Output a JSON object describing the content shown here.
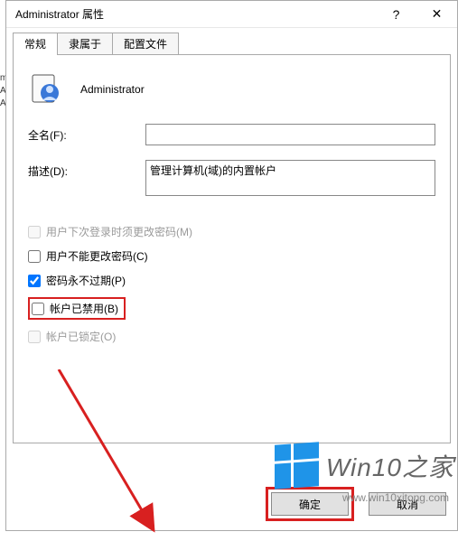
{
  "titlebar": {
    "title": "Administrator 属性",
    "help": "?",
    "close": "✕"
  },
  "tabs": {
    "general": "常规",
    "memberof": "隶属于",
    "profile": "配置文件"
  },
  "header": {
    "username": "Administrator"
  },
  "fields": {
    "fullname_label": "全名(F):",
    "fullname_value": "",
    "desc_label": "描述(D):",
    "desc_value": "管理计算机(域)的内置帐户"
  },
  "checkboxes": {
    "must_change": "用户下次登录时须更改密码(M)",
    "cannot_change": "用户不能更改密码(C)",
    "never_expire": "密码永不过期(P)",
    "disabled": "帐户已禁用(B)",
    "locked": "帐户已锁定(O)"
  },
  "buttons": {
    "ok": "确定",
    "cancel": "取消"
  },
  "watermark": {
    "text": "Win10之家",
    "url": "www.win10xitong.com"
  }
}
